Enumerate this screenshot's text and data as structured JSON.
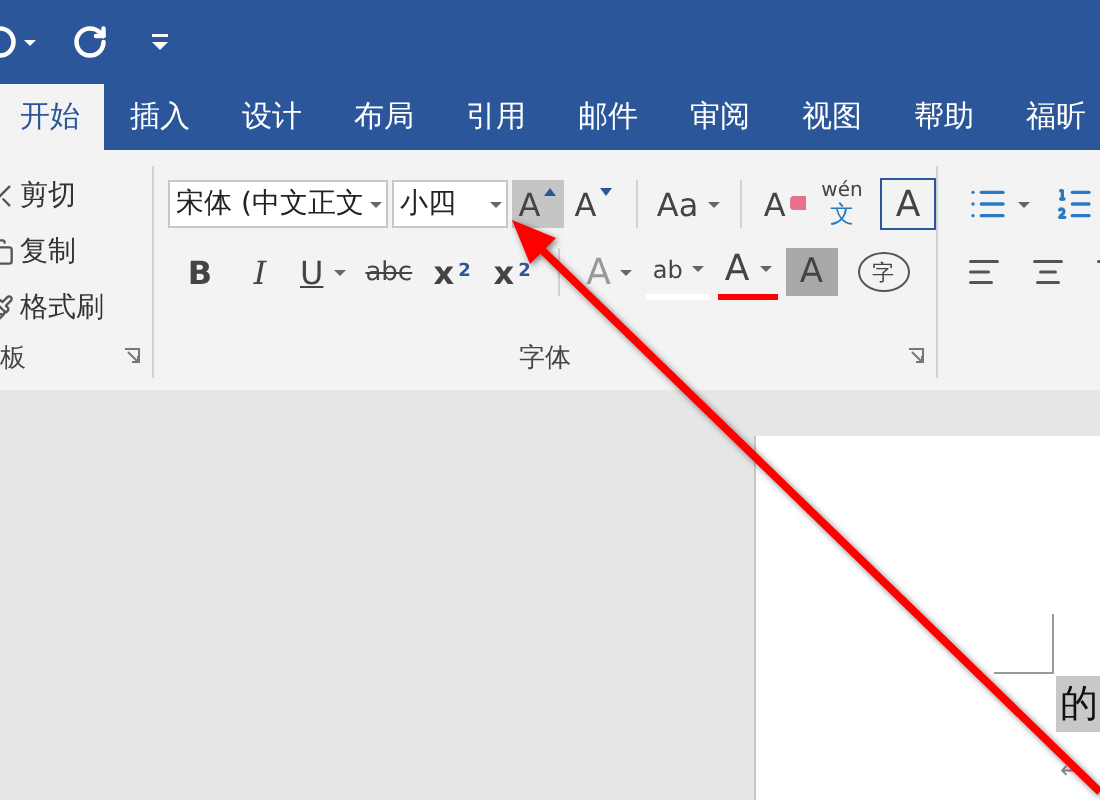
{
  "tabs": [
    {
      "label": "开始",
      "selected": true
    },
    {
      "label": "插入",
      "selected": false
    },
    {
      "label": "设计",
      "selected": false
    },
    {
      "label": "布局",
      "selected": false
    },
    {
      "label": "引用",
      "selected": false
    },
    {
      "label": "邮件",
      "selected": false
    },
    {
      "label": "审阅",
      "selected": false
    },
    {
      "label": "视图",
      "selected": false
    },
    {
      "label": "帮助",
      "selected": false
    },
    {
      "label": "福昕",
      "selected": false
    }
  ],
  "clipboard": {
    "items": [
      {
        "kind": "cut",
        "label": "剪切"
      },
      {
        "kind": "copy",
        "label": "复制"
      },
      {
        "kind": "painter",
        "label": "格式刷"
      }
    ],
    "label": "板"
  },
  "font": {
    "label": "字体",
    "font_name": "宋体 (中文正文",
    "font_size": "小四",
    "row1": [
      {
        "kind": "grow",
        "label": "A",
        "hovered": true
      },
      {
        "kind": "shrink",
        "label": "A",
        "hovered": false
      },
      {
        "kind": "divider"
      },
      {
        "kind": "case",
        "label": "Aa"
      },
      {
        "kind": "divider"
      },
      {
        "kind": "clear",
        "label": "A"
      },
      {
        "kind": "pinyin",
        "label": "wén",
        "sub": "文"
      },
      {
        "kind": "border",
        "label": "A"
      }
    ],
    "row2": [
      {
        "kind": "bold",
        "label": "B"
      },
      {
        "kind": "italic",
        "label": "I"
      },
      {
        "kind": "underline",
        "label": "U"
      },
      {
        "kind": "strike",
        "label": "abc"
      },
      {
        "kind": "subscript",
        "label": "x",
        "sub": "2"
      },
      {
        "kind": "superscript",
        "label": "x",
        "sub": "2"
      },
      {
        "kind": "divider"
      },
      {
        "kind": "effects",
        "label": "A",
        "disabled": true
      },
      {
        "kind": "highlight",
        "label": "ab"
      },
      {
        "kind": "color",
        "label": "A",
        "color": "#ff0000"
      },
      {
        "kind": "shade",
        "label": "A"
      },
      {
        "kind": "enclose",
        "label": "字"
      }
    ]
  },
  "document": {
    "selected_text": "的",
    "return_mark": "↵"
  }
}
